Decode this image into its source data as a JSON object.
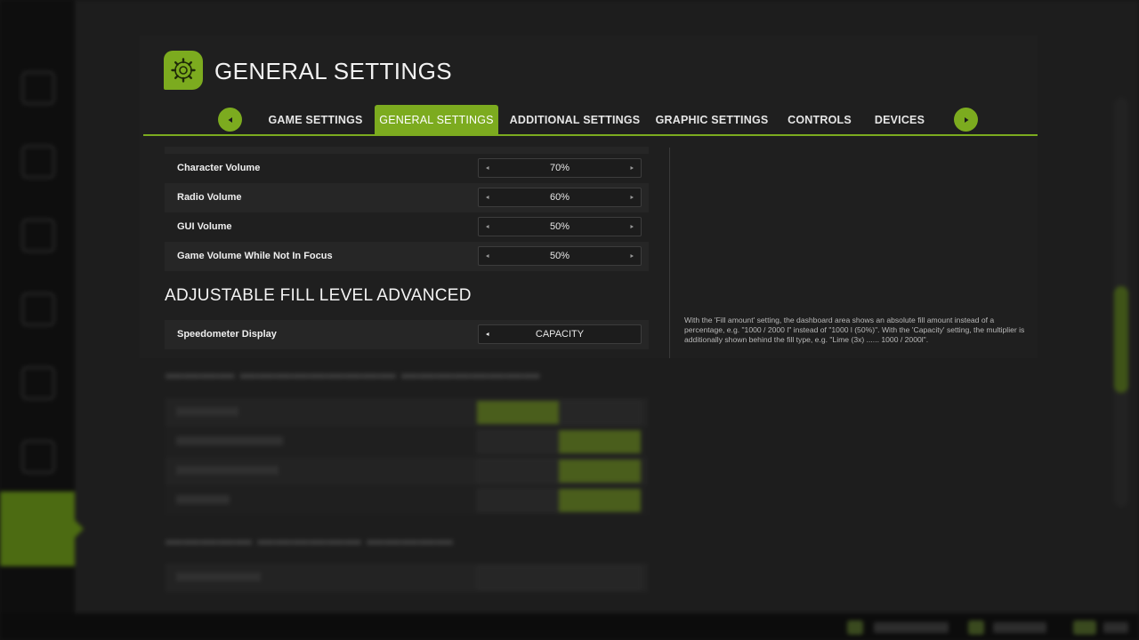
{
  "dialog": {
    "title": "GENERAL SETTINGS",
    "header_icon": "gear-icon"
  },
  "tabs": [
    {
      "label": "GAME SETTINGS",
      "active": false
    },
    {
      "label": "GENERAL SETTINGS",
      "active": true
    },
    {
      "label": "ADDITIONAL SETTINGS",
      "active": false
    },
    {
      "label": "GRAPHIC SETTINGS",
      "active": false
    },
    {
      "label": "CONTROLS",
      "active": false
    },
    {
      "label": "DEVICES",
      "active": false
    }
  ],
  "tab_nav": {
    "prev_icon": "arrow-left-icon",
    "next_icon": "arrow-right-icon"
  },
  "settings": [
    {
      "label": "Character Volume",
      "value": "70%"
    },
    {
      "label": "Radio Volume",
      "value": "60%"
    },
    {
      "label": "GUI Volume",
      "value": "50%"
    },
    {
      "label": "Game Volume While Not In Focus",
      "value": "50%"
    }
  ],
  "section": {
    "heading": "ADJUSTABLE FILL LEVEL ADVANCED",
    "settings": [
      {
        "label": "Speedometer Display",
        "value": "CAPACITY"
      }
    ]
  },
  "info_text": "With the 'Fill amount' setting, the dashboard area shows an absolute fill amount instead of a percentage, e.g. \"1000 / 2000 l\" instead of \"1000 l (50%)\". With the 'Capacity' setting, the multiplier is additionally shown behind the fill type, e.g. \"Lime (3x) ...... 1000 / 2000l\".",
  "colors": {
    "accent": "#7cab1f",
    "panel": "#1f1f1f",
    "row_alt": "#262626",
    "background": "#151515"
  }
}
